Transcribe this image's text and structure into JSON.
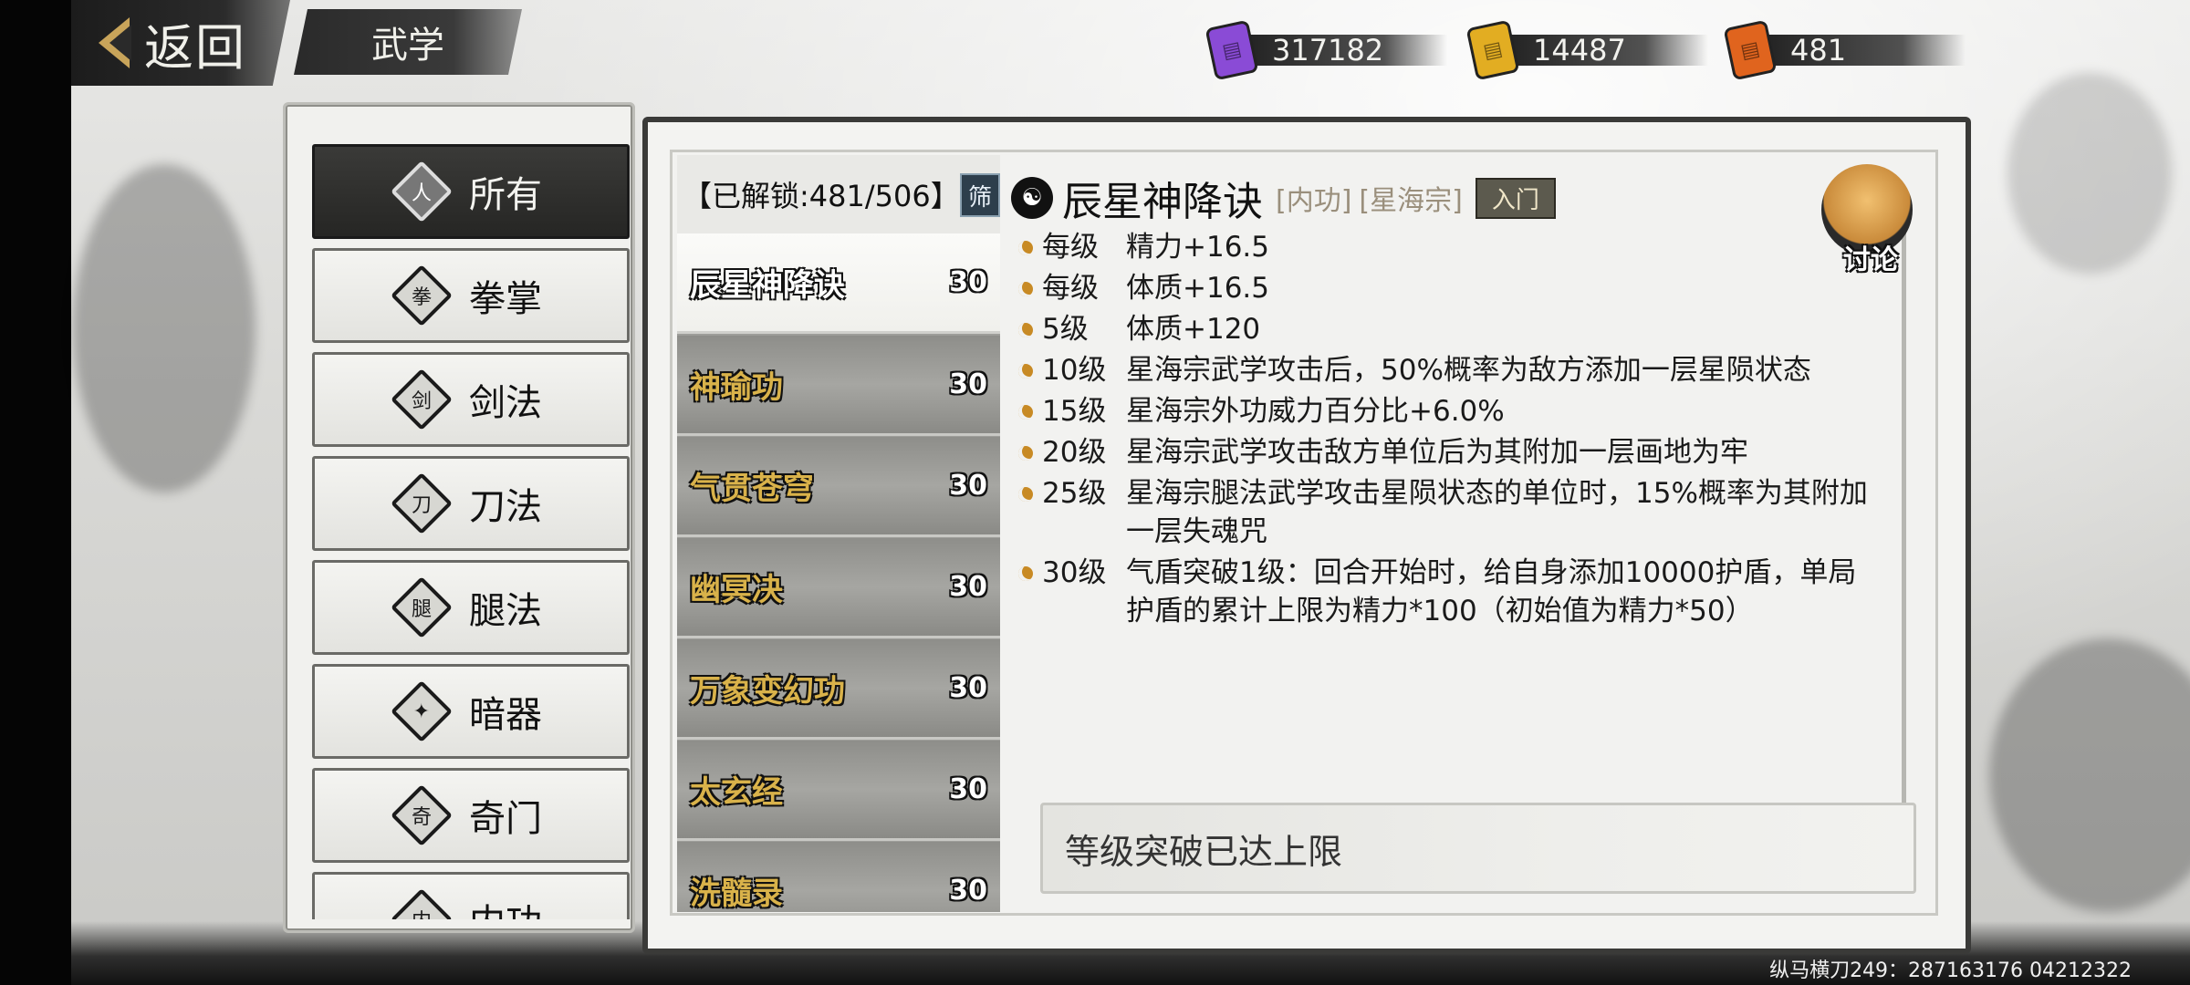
{
  "header": {
    "back_label": "返回",
    "title": "武学"
  },
  "currencies": [
    {
      "icon": "purple-scroll-icon",
      "value": "317182",
      "color": "#8a4bd6"
    },
    {
      "icon": "gold-scroll-icon",
      "value": "14487",
      "color": "#e2ad22"
    },
    {
      "icon": "flame-scroll-icon",
      "value": "481",
      "color": "#e0641e"
    }
  ],
  "categories": [
    {
      "label": "所有",
      "icon": "person-icon",
      "glyph": "人",
      "active": true
    },
    {
      "label": "拳掌",
      "icon": "fist-icon",
      "glyph": "拳",
      "active": false
    },
    {
      "label": "剑法",
      "icon": "sword-icon",
      "glyph": "剑",
      "active": false
    },
    {
      "label": "刀法",
      "icon": "blade-icon",
      "glyph": "刀",
      "active": false
    },
    {
      "label": "腿法",
      "icon": "kick-icon",
      "glyph": "腿",
      "active": false
    },
    {
      "label": "暗器",
      "icon": "shuriken-icon",
      "glyph": "✦",
      "active": false
    },
    {
      "label": "奇门",
      "icon": "scroll-icon",
      "glyph": "奇",
      "active": false
    },
    {
      "label": "内功",
      "icon": "inner-icon",
      "glyph": "内",
      "active": false
    }
  ],
  "skill_list": {
    "unlock_text": "【已解锁:481/506】",
    "filter_label": "筛",
    "skills": [
      {
        "name": "辰星神降诀",
        "level": "30",
        "active": true
      },
      {
        "name": "神瑜功",
        "level": "30",
        "active": false
      },
      {
        "name": "气贯苍穹",
        "level": "30",
        "active": false
      },
      {
        "name": "幽冥决",
        "level": "30",
        "active": false
      },
      {
        "name": "万象变幻功",
        "level": "30",
        "active": false
      },
      {
        "name": "太玄经",
        "level": "30",
        "active": false
      },
      {
        "name": "洗髓录",
        "level": "30",
        "active": false
      }
    ]
  },
  "detail": {
    "icon": "martial-stance-icon",
    "title": "辰星神降诀",
    "tag_type": "[内功]",
    "tag_sect": "[星海宗]",
    "rank": "入门",
    "effects": [
      {
        "level": "每级",
        "text": "精力+16.5"
      },
      {
        "level": "每级",
        "text": "体质+16.5"
      },
      {
        "level": "5级",
        "text": "体质+120"
      },
      {
        "level": "10级",
        "text": "星海宗武学攻击后，50%概率为敌方添加一层星陨状态"
      },
      {
        "level": "15级",
        "text": "星海宗外功威力百分比+6.0%"
      },
      {
        "level": "20级",
        "text": "星海宗武学攻击敌方单位后为其附加一层画地为牢"
      },
      {
        "level": "25级",
        "text": "星海宗腿法武学攻击星陨状态的单位时，15%概率为其附加一层失魂咒"
      },
      {
        "level": "30级",
        "text": "气盾突破1级：回合开始时，给自身添加10000护盾，单局护盾的累计上限为精力*100（初始值为精力*50）"
      }
    ],
    "discuss_label": "讨论",
    "breakthrough_text": "等级突破已达上限"
  },
  "watermark": "纵马横刀249：287163176 04212322"
}
